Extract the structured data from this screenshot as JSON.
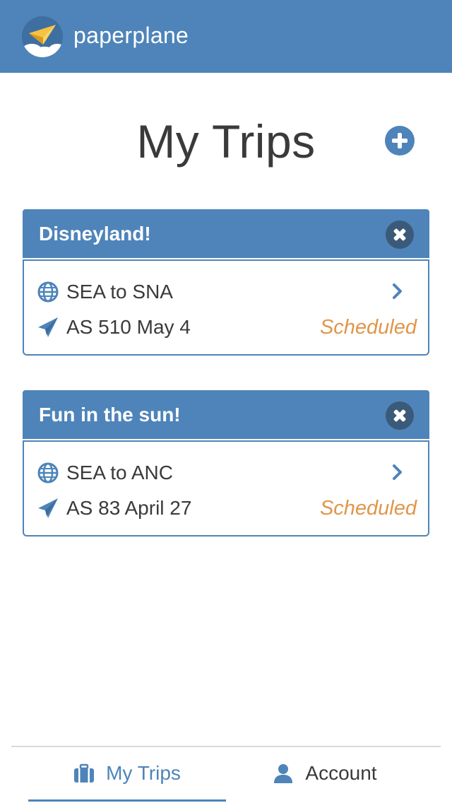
{
  "header": {
    "brand": "paperplane",
    "logo_icon": "paper-plane-logo-icon"
  },
  "page": {
    "title": "My Trips",
    "add_icon": "plus-circle-icon"
  },
  "trips": [
    {
      "name": "Disneyland!",
      "route": "SEA to SNA",
      "flight": "AS 510 May 4",
      "status": "Scheduled"
    },
    {
      "name": "Fun in the sun!",
      "route": "SEA to ANC",
      "flight": "AS 83 April 27",
      "status": "Scheduled"
    }
  ],
  "tabs": {
    "trips_label": "My Trips",
    "account_label": "Account"
  },
  "colors": {
    "brand_blue": "#4e84b9",
    "close_dark": "#3b5a79",
    "status_orange": "#e0964a",
    "text_dark": "#3a3a3a"
  }
}
